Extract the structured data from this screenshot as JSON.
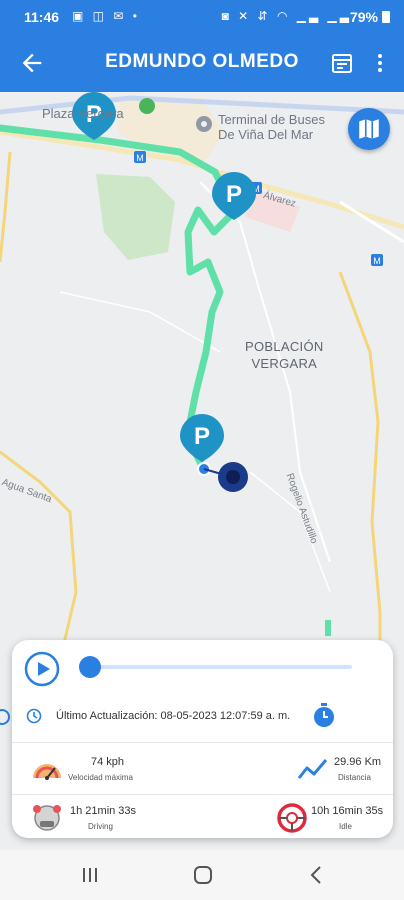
{
  "status_bar": {
    "time": "11:46",
    "battery": "79%",
    "left_icons": [
      "image-icon",
      "vpn-icon",
      "gmail-icon",
      "dot-icon"
    ],
    "right_icons": [
      "nfc-icon",
      "mute-icon",
      "vibrate-icon",
      "wifi-icon",
      "signal-icon",
      "signal-icon-2",
      "battery-icon"
    ]
  },
  "app_bar": {
    "title": "EDMUNDO OLMEDO",
    "back_icon": "arrow-left-icon",
    "calendar_icon": "calendar-icon",
    "menu_icon": "more-vert-icon"
  },
  "map": {
    "labels": {
      "poblacion_line1": "POBLACIÓN",
      "poblacion_line2": "VERGARA",
      "terminal_line1": "Terminal de Buses",
      "terminal_line2": "De Viña Del Mar",
      "plaza": "Plaza Vergara",
      "agua_santa": "Agua Santa",
      "rogelio": "Rogelio Astudillo",
      "alvarez": "Álvarez"
    },
    "parking_marker_text": "P",
    "route_color": "#5fe0a8",
    "marker_color": "#1f93c6",
    "map_toggle_icon": "map-icon"
  },
  "panel": {
    "play_icon": "play-icon",
    "progress": 0.0,
    "update_text": "Último Actualización: 08-05-2023 12:07:59 a. m.",
    "stats": {
      "max_speed_value": "74 kph",
      "max_speed_label": "Velocidad máxima",
      "distance_value": "29.96 Km",
      "distance_label": "Distancia",
      "driving_value": "1h 21min 33s",
      "driving_label": "Driving",
      "idle_value": "10h 16min 35s",
      "idle_label": "Idle"
    }
  },
  "colors": {
    "primary": "#2a7fe0",
    "route": "#5fe0a8",
    "marker": "#1f93c6",
    "vehicle": "#1a3a8a"
  }
}
